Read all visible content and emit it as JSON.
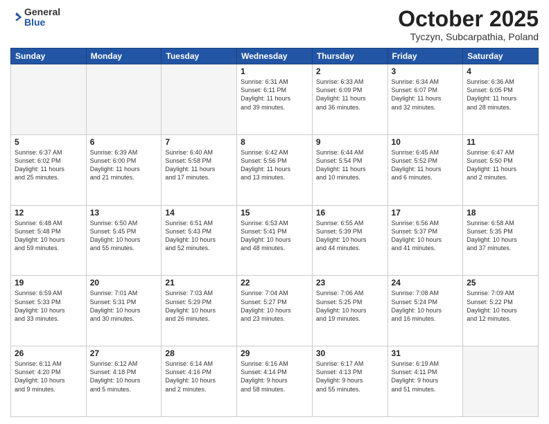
{
  "header": {
    "logo_general": "General",
    "logo_blue": "Blue",
    "month": "October 2025",
    "location": "Tyczyn, Subcarpathia, Poland"
  },
  "days_of_week": [
    "Sunday",
    "Monday",
    "Tuesday",
    "Wednesday",
    "Thursday",
    "Friday",
    "Saturday"
  ],
  "weeks": [
    [
      {
        "day": "",
        "info": ""
      },
      {
        "day": "",
        "info": ""
      },
      {
        "day": "",
        "info": ""
      },
      {
        "day": "1",
        "info": "Sunrise: 6:31 AM\nSunset: 6:11 PM\nDaylight: 11 hours\nand 39 minutes."
      },
      {
        "day": "2",
        "info": "Sunrise: 6:33 AM\nSunset: 6:09 PM\nDaylight: 11 hours\nand 36 minutes."
      },
      {
        "day": "3",
        "info": "Sunrise: 6:34 AM\nSunset: 6:07 PM\nDaylight: 11 hours\nand 32 minutes."
      },
      {
        "day": "4",
        "info": "Sunrise: 6:36 AM\nSunset: 6:05 PM\nDaylight: 11 hours\nand 28 minutes."
      }
    ],
    [
      {
        "day": "5",
        "info": "Sunrise: 6:37 AM\nSunset: 6:02 PM\nDaylight: 11 hours\nand 25 minutes."
      },
      {
        "day": "6",
        "info": "Sunrise: 6:39 AM\nSunset: 6:00 PM\nDaylight: 11 hours\nand 21 minutes."
      },
      {
        "day": "7",
        "info": "Sunrise: 6:40 AM\nSunset: 5:58 PM\nDaylight: 11 hours\nand 17 minutes."
      },
      {
        "day": "8",
        "info": "Sunrise: 6:42 AM\nSunset: 5:56 PM\nDaylight: 11 hours\nand 13 minutes."
      },
      {
        "day": "9",
        "info": "Sunrise: 6:44 AM\nSunset: 5:54 PM\nDaylight: 11 hours\nand 10 minutes."
      },
      {
        "day": "10",
        "info": "Sunrise: 6:45 AM\nSunset: 5:52 PM\nDaylight: 11 hours\nand 6 minutes."
      },
      {
        "day": "11",
        "info": "Sunrise: 6:47 AM\nSunset: 5:50 PM\nDaylight: 11 hours\nand 2 minutes."
      }
    ],
    [
      {
        "day": "12",
        "info": "Sunrise: 6:48 AM\nSunset: 5:48 PM\nDaylight: 10 hours\nand 59 minutes."
      },
      {
        "day": "13",
        "info": "Sunrise: 6:50 AM\nSunset: 5:45 PM\nDaylight: 10 hours\nand 55 minutes."
      },
      {
        "day": "14",
        "info": "Sunrise: 6:51 AM\nSunset: 5:43 PM\nDaylight: 10 hours\nand 52 minutes."
      },
      {
        "day": "15",
        "info": "Sunrise: 6:53 AM\nSunset: 5:41 PM\nDaylight: 10 hours\nand 48 minutes."
      },
      {
        "day": "16",
        "info": "Sunrise: 6:55 AM\nSunset: 5:39 PM\nDaylight: 10 hours\nand 44 minutes."
      },
      {
        "day": "17",
        "info": "Sunrise: 6:56 AM\nSunset: 5:37 PM\nDaylight: 10 hours\nand 41 minutes."
      },
      {
        "day": "18",
        "info": "Sunrise: 6:58 AM\nSunset: 5:35 PM\nDaylight: 10 hours\nand 37 minutes."
      }
    ],
    [
      {
        "day": "19",
        "info": "Sunrise: 6:59 AM\nSunset: 5:33 PM\nDaylight: 10 hours\nand 33 minutes."
      },
      {
        "day": "20",
        "info": "Sunrise: 7:01 AM\nSunset: 5:31 PM\nDaylight: 10 hours\nand 30 minutes."
      },
      {
        "day": "21",
        "info": "Sunrise: 7:03 AM\nSunset: 5:29 PM\nDaylight: 10 hours\nand 26 minutes."
      },
      {
        "day": "22",
        "info": "Sunrise: 7:04 AM\nSunset: 5:27 PM\nDaylight: 10 hours\nand 23 minutes."
      },
      {
        "day": "23",
        "info": "Sunrise: 7:06 AM\nSunset: 5:25 PM\nDaylight: 10 hours\nand 19 minutes."
      },
      {
        "day": "24",
        "info": "Sunrise: 7:08 AM\nSunset: 5:24 PM\nDaylight: 10 hours\nand 16 minutes."
      },
      {
        "day": "25",
        "info": "Sunrise: 7:09 AM\nSunset: 5:22 PM\nDaylight: 10 hours\nand 12 minutes."
      }
    ],
    [
      {
        "day": "26",
        "info": "Sunrise: 6:11 AM\nSunset: 4:20 PM\nDaylight: 10 hours\nand 9 minutes."
      },
      {
        "day": "27",
        "info": "Sunrise: 6:12 AM\nSunset: 4:18 PM\nDaylight: 10 hours\nand 5 minutes."
      },
      {
        "day": "28",
        "info": "Sunrise: 6:14 AM\nSunset: 4:16 PM\nDaylight: 10 hours\nand 2 minutes."
      },
      {
        "day": "29",
        "info": "Sunrise: 6:16 AM\nSunset: 4:14 PM\nDaylight: 9 hours\nand 58 minutes."
      },
      {
        "day": "30",
        "info": "Sunrise: 6:17 AM\nSunset: 4:13 PM\nDaylight: 9 hours\nand 55 minutes."
      },
      {
        "day": "31",
        "info": "Sunrise: 6:19 AM\nSunset: 4:11 PM\nDaylight: 9 hours\nand 51 minutes."
      },
      {
        "day": "",
        "info": ""
      }
    ]
  ]
}
